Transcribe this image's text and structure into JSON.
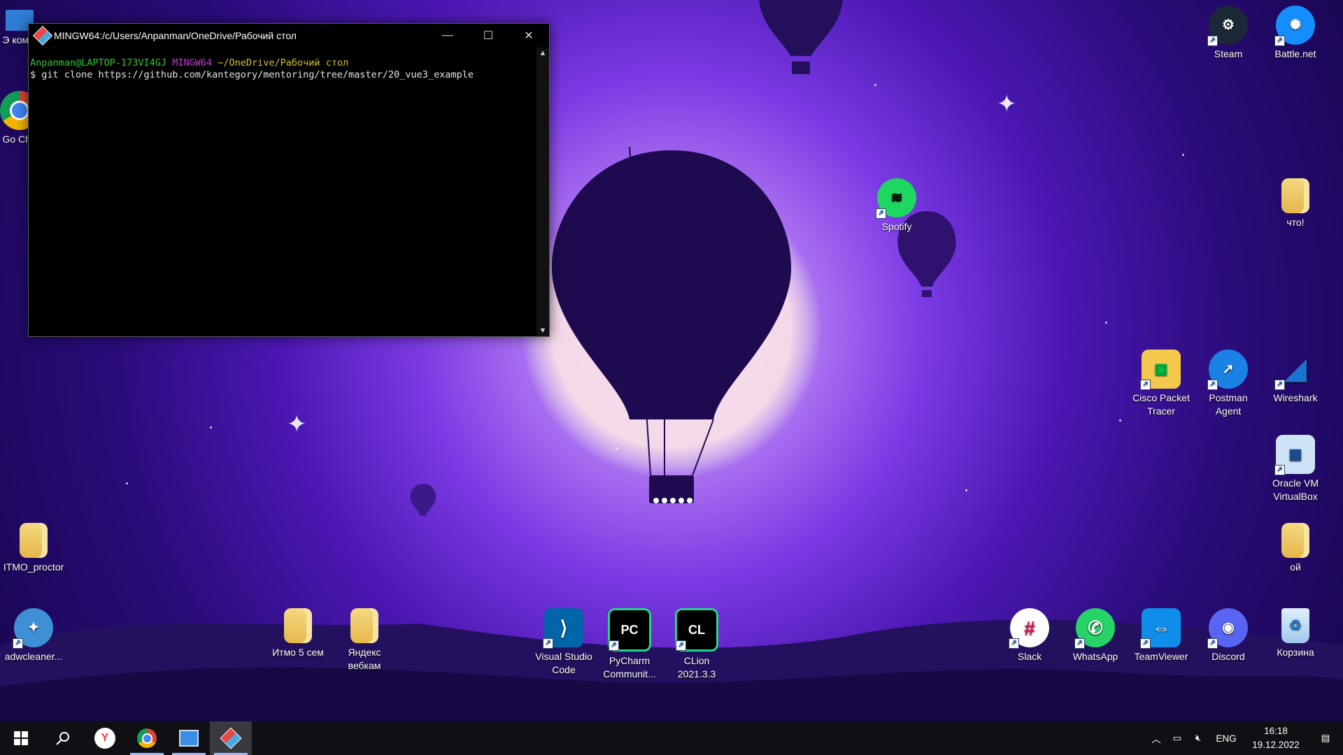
{
  "terminal": {
    "title": "MINGW64:/c/Users/Anpanman/OneDrive/Рабочий стол",
    "prompt_user": "Anpanman@LAPTOP-173VI4GJ",
    "prompt_env": "MINGW64",
    "prompt_path": "~/OneDrive/Рабочий стол",
    "command": "$ git clone https://github.com/kantegory/mentoring/tree/master/20_vue3_example",
    "minimize": "—",
    "maximize": "☐",
    "close": "✕"
  },
  "desktop_icons": [
    {
      "label": "Steam"
    },
    {
      "label": "Battle.net"
    },
    {
      "label": "Spotify"
    },
    {
      "label": "что!"
    },
    {
      "label": "Cisco Packet Tracer"
    },
    {
      "label": "Postman Agent"
    },
    {
      "label": "Wireshark"
    },
    {
      "label": "Oracle VM VirtualBox"
    },
    {
      "label": "ой"
    },
    {
      "label": "ITMO_proctor"
    },
    {
      "label": "adwcleaner..."
    },
    {
      "label": "Итмо 5 сем"
    },
    {
      "label": "Яндекс вебкам"
    },
    {
      "label": "Visual Studio Code"
    },
    {
      "label": "PyCharm Communit..."
    },
    {
      "label": "CLion 2021.3.3"
    },
    {
      "label": "Slack"
    },
    {
      "label": "WhatsApp"
    },
    {
      "label": "TeamViewer"
    },
    {
      "label": "Discord"
    },
    {
      "label": "Корзина"
    },
    {
      "label": "Э комп"
    },
    {
      "label": "Go Chr"
    }
  ],
  "taskbar": {
    "start_icon": "windows-icon",
    "search_icon": "search-icon",
    "language": "ENG",
    "time": "16:18",
    "date": "19.12.2022"
  }
}
